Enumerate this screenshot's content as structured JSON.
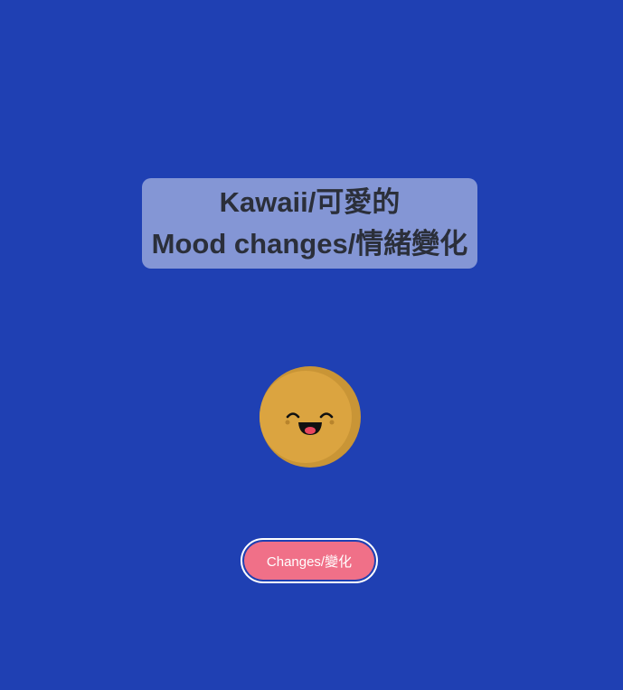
{
  "title": {
    "line1": "Kawaii/可愛的",
    "line2": "Mood changes/情緒變化"
  },
  "mood_face": {
    "icon": "smiling-face-icon",
    "expression": "happy",
    "face_color": "#dba440",
    "shade_color": "#c99536"
  },
  "button": {
    "label": "Changes/變化",
    "color": "#f07088",
    "text_color": "#ffffff"
  },
  "colors": {
    "background": "#1f40b3",
    "title_text": "#2b2f3a"
  }
}
